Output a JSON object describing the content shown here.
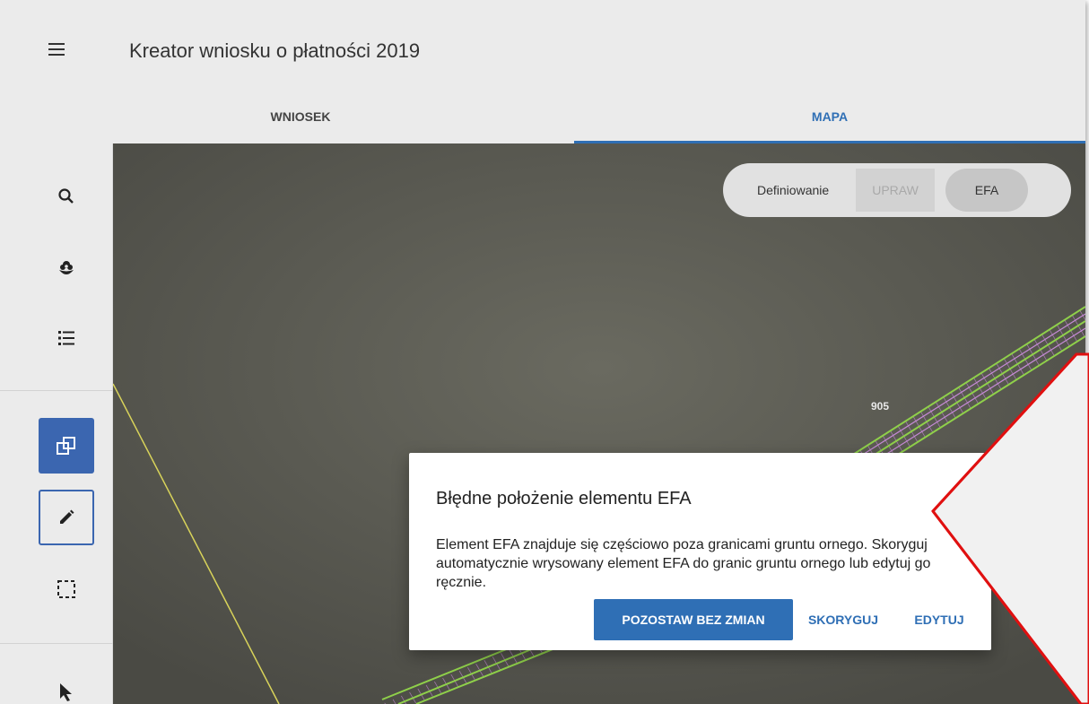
{
  "app": {
    "title": "Kreator wniosku o płatności 2019"
  },
  "tabs": [
    {
      "label": "WNIOSEK",
      "active": false
    },
    {
      "label": "MAPA",
      "active": true
    }
  ],
  "colors": {
    "accent": "#2f6fb5",
    "callout_border": "#e01010",
    "map_background": "#5a5a52"
  },
  "sidebar": {
    "tools": [
      {
        "icon": "search-icon"
      },
      {
        "icon": "flower-icon"
      },
      {
        "icon": "list-icon"
      },
      {
        "icon": "copy-icon",
        "active": true
      },
      {
        "icon": "pencil-icon",
        "selected": true
      },
      {
        "icon": "selection-box-icon"
      },
      {
        "icon": "cursor-icon"
      }
    ]
  },
  "map": {
    "mode_toggle": {
      "label": "Definiowanie",
      "option_uprawy": "UPRAW",
      "option_efa": "EFA",
      "selected": "EFA"
    },
    "parcel_label": "905"
  },
  "dialog": {
    "title": "Błędne położenie elementu EFA",
    "body": "Element EFA znajduje się częściowo poza granicami gruntu ornego. Skoryguj automatycznie wrysowany element EFA do granic gruntu ornego lub edytuj go ręcznie.",
    "buttons": {
      "keep": "POZOSTAW BEZ ZMIAN",
      "correct": "SKORYGUJ",
      "edit": "EDYTUJ"
    }
  }
}
